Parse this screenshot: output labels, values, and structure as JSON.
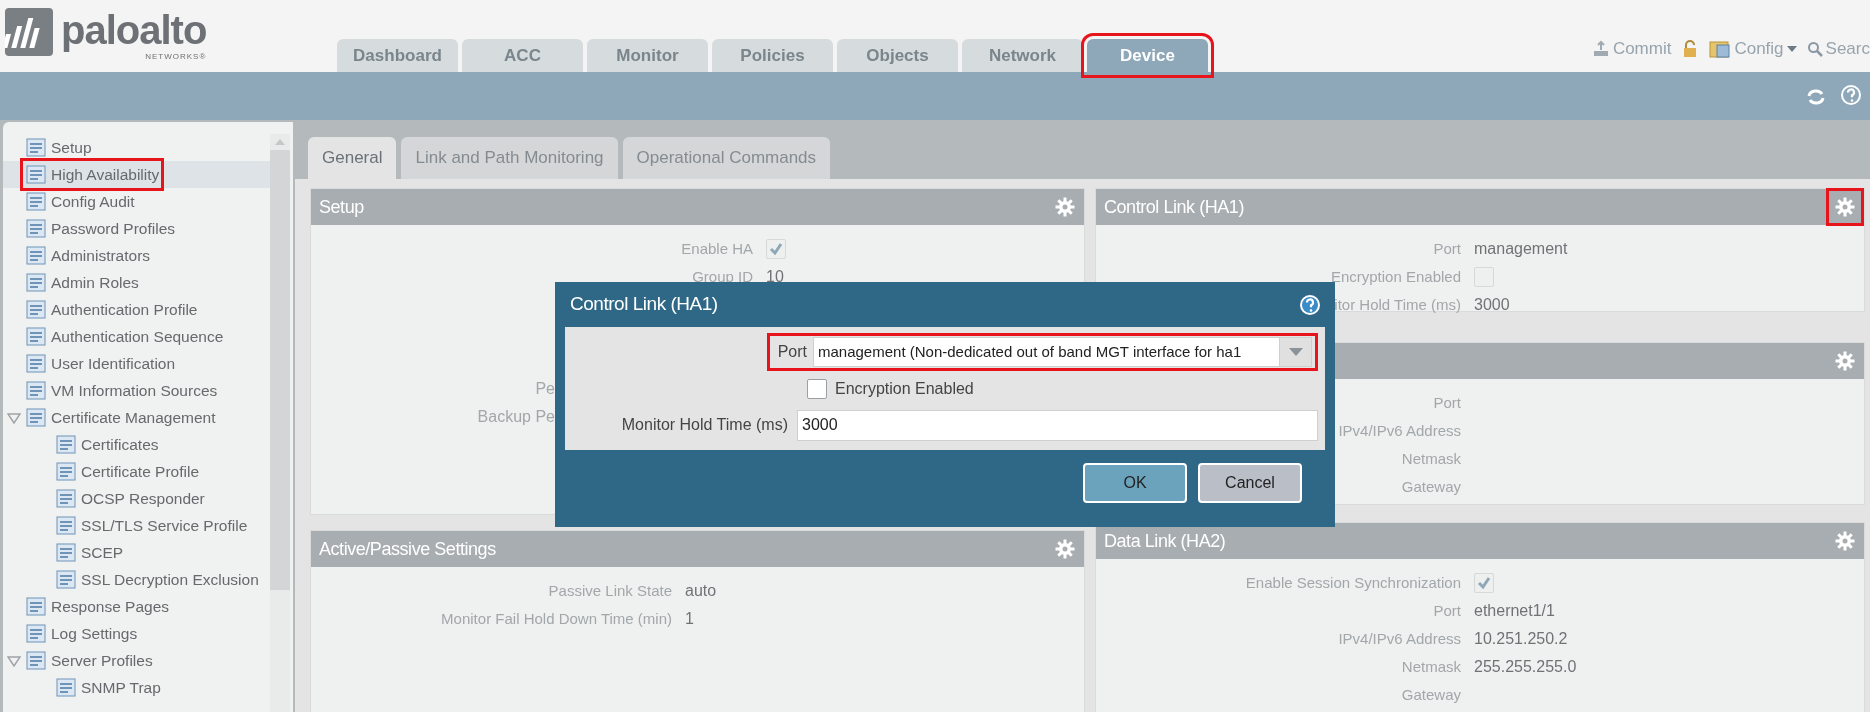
{
  "logo": {
    "name": "paloalto",
    "sub": "NETWORKS®"
  },
  "nav_tabs": [
    {
      "label": "Dashboard",
      "selected": false,
      "highlighted": false
    },
    {
      "label": "ACC",
      "selected": false,
      "highlighted": false
    },
    {
      "label": "Monitor",
      "selected": false,
      "highlighted": false
    },
    {
      "label": "Policies",
      "selected": false,
      "highlighted": false
    },
    {
      "label": "Objects",
      "selected": false,
      "highlighted": false
    },
    {
      "label": "Network",
      "selected": false,
      "highlighted": false
    },
    {
      "label": "Device",
      "selected": true,
      "highlighted": true
    }
  ],
  "header_actions": [
    {
      "kind": "commit",
      "label": "Commit"
    },
    {
      "kind": "lock"
    },
    {
      "kind": "config",
      "label": "Config"
    },
    {
      "kind": "search",
      "label": "Searc"
    }
  ],
  "sidebar": {
    "items": [
      {
        "label": "Setup",
        "selected": false,
        "highlighted": false
      },
      {
        "label": "High Availability",
        "selected": true,
        "highlighted": true
      },
      {
        "label": "Config Audit",
        "selected": false,
        "highlighted": false
      },
      {
        "label": "Password Profiles",
        "selected": false,
        "highlighted": false
      },
      {
        "label": "Administrators",
        "selected": false,
        "highlighted": false
      },
      {
        "label": "Admin Roles",
        "selected": false,
        "highlighted": false
      },
      {
        "label": "Authentication Profile",
        "selected": false,
        "highlighted": false
      },
      {
        "label": "Authentication Sequence",
        "selected": false,
        "highlighted": false
      },
      {
        "label": "User Identification",
        "selected": false,
        "highlighted": false
      },
      {
        "label": "VM Information Sources",
        "selected": false,
        "highlighted": false
      },
      {
        "label": "Certificate Management",
        "selected": false,
        "highlighted": false,
        "expanded": true,
        "children": [
          {
            "label": "Certificates",
            "selected": false,
            "highlighted": false
          },
          {
            "label": "Certificate Profile",
            "selected": false,
            "highlighted": false
          },
          {
            "label": "OCSP Responder",
            "selected": false,
            "highlighted": false
          },
          {
            "label": "SSL/TLS Service Profile",
            "selected": false,
            "highlighted": false
          },
          {
            "label": "SCEP",
            "selected": false,
            "highlighted": false
          },
          {
            "label": "SSL Decryption Exclusion",
            "selected": false,
            "highlighted": false
          }
        ]
      },
      {
        "label": "Response Pages",
        "selected": false,
        "highlighted": false
      },
      {
        "label": "Log Settings",
        "selected": false,
        "highlighted": false
      },
      {
        "label": "Server Profiles",
        "selected": false,
        "highlighted": false,
        "expanded": true,
        "children": [
          {
            "label": "SNMP Trap",
            "selected": false,
            "highlighted": false
          }
        ]
      }
    ]
  },
  "content_tabs": [
    {
      "label": "General",
      "selected": true
    },
    {
      "label": "Link and Path Monitoring",
      "selected": false
    },
    {
      "label": "Operational Commands",
      "selected": false
    }
  ],
  "columns": [
    {
      "panels": [
        {
          "title": "Setup",
          "gear_highlighted": false,
          "rows": [
            {
              "kind": "checkbox",
              "label": "Enable HA",
              "checked": true
            },
            {
              "kind": "text",
              "label": "Group ID",
              "value": "10"
            },
            {
              "kind": "cut",
              "label": "Pe"
            },
            {
              "kind": "cut",
              "label": "Backup Pe"
            }
          ]
        },
        {
          "title": "Active/Passive Settings",
          "gear_highlighted": false,
          "rows": [
            {
              "kind": "text",
              "label": "Passive Link State",
              "value": "auto"
            },
            {
              "kind": "text",
              "label": "Monitor Fail Hold Down Time (min)",
              "value": "1"
            }
          ]
        }
      ]
    },
    {
      "panels": [
        {
          "title": "Control Link (HA1)",
          "gear_highlighted": true,
          "rows": [
            {
              "kind": "text",
              "label": "Port",
              "value": "management"
            },
            {
              "kind": "checkbox",
              "label": "Encryption Enabled",
              "checked": false
            },
            {
              "kind": "text",
              "label": "itor Hold Time (ms)",
              "value": "3000"
            }
          ]
        },
        {
          "gear_highlighted": false,
          "rows": [
            {
              "kind": "text",
              "label": "Port"
            },
            {
              "kind": "text",
              "label": "IPv4/IPv6 Address"
            },
            {
              "kind": "text",
              "label": "Netmask"
            },
            {
              "kind": "text",
              "label": "Gateway"
            }
          ]
        },
        {
          "title": "Data Link (HA2)",
          "gear_highlighted": false,
          "rows": [
            {
              "kind": "checkbox",
              "label": "Enable Session Synchronization",
              "checked": true
            },
            {
              "kind": "text",
              "label": "Port",
              "value": "ethernet1/1"
            },
            {
              "kind": "text",
              "label": "IPv4/IPv6 Address",
              "value": "10.251.250.2"
            },
            {
              "kind": "text",
              "label": "Netmask",
              "value": "255.255.255.0"
            },
            {
              "kind": "text",
              "label": "Gateway"
            }
          ]
        }
      ]
    }
  ],
  "dialog": {
    "title": "Control Link (HA1)",
    "fields": [
      {
        "kind": "select",
        "label": "Port",
        "value": "management (Non-dedicated out of band MGT interface for ha1",
        "highlighted": true
      },
      {
        "kind": "checkbox",
        "label": "Encryption Enabled",
        "checked": false
      },
      {
        "kind": "text",
        "label": "Monitor Hold Time (ms)",
        "value": "3000"
      }
    ],
    "buttons": [
      {
        "kind": "primary",
        "label": "OK"
      },
      {
        "kind": "secondary",
        "label": "Cancel"
      }
    ]
  }
}
